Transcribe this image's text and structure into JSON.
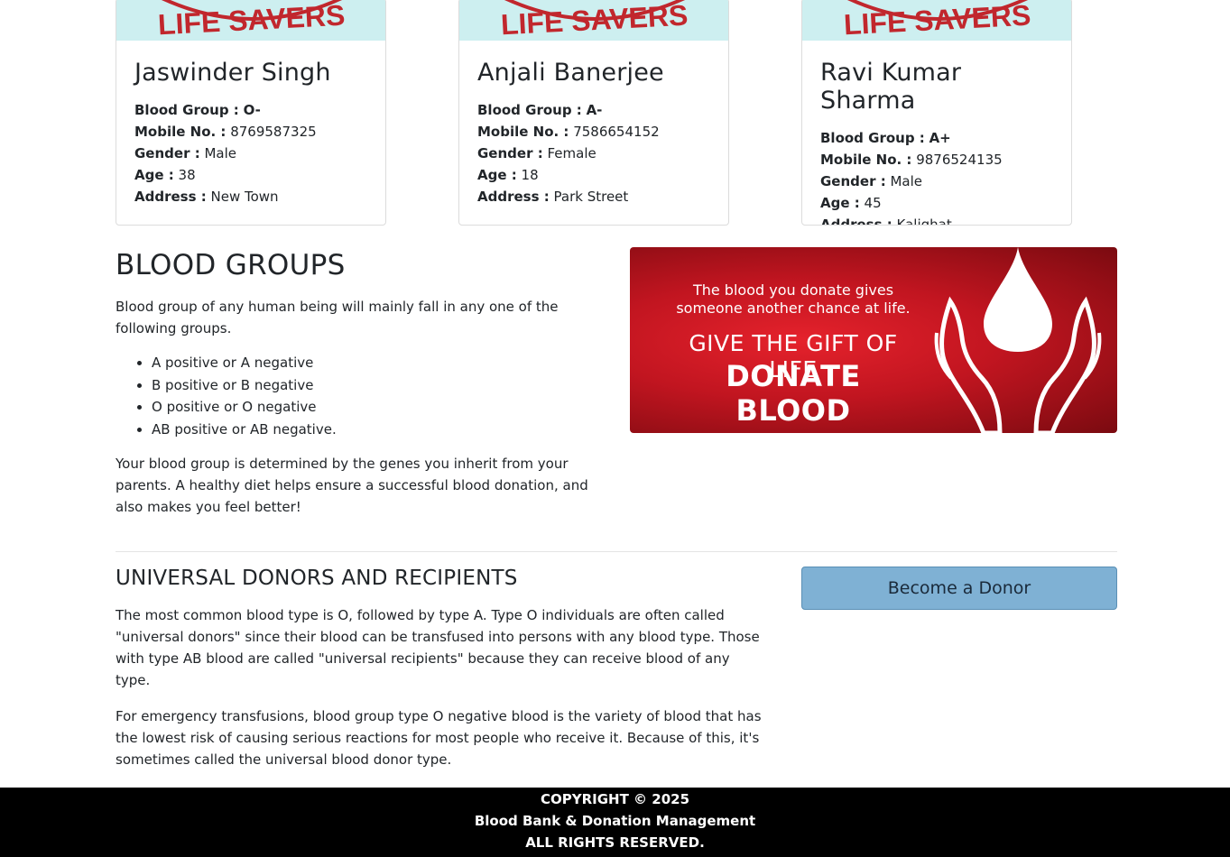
{
  "donors": [
    {
      "image_text": "LIFE SAVERS",
      "name": "Jaswinder Singh",
      "blood_group_label": "Blood Group :",
      "blood_group": "O-",
      "mobile_label": "Mobile No. :",
      "mobile": "8769587325",
      "gender_label": "Gender :",
      "gender": "Male",
      "age_label": "Age :",
      "age": "38",
      "address_label": "Address :",
      "address": "New Town"
    },
    {
      "image_text": "LIFE SAVERS",
      "name": "Anjali Banerjee",
      "blood_group_label": "Blood Group :",
      "blood_group": "A-",
      "mobile_label": "Mobile No. :",
      "mobile": "7586654152",
      "gender_label": "Gender :",
      "gender": "Female",
      "age_label": "Age :",
      "age": "18",
      "address_label": "Address :",
      "address": "Park Street"
    },
    {
      "image_text": "LIFE SAVERS",
      "name": "Ravi Kumar Sharma",
      "blood_group_label": "Blood Group :",
      "blood_group": "A+",
      "mobile_label": "Mobile No. :",
      "mobile": "9876524135",
      "gender_label": "Gender :",
      "gender": "Male",
      "age_label": "Age :",
      "age": "45",
      "address_label": "Address :",
      "address": "Kalighat"
    }
  ],
  "blood_groups": {
    "title": "BLOOD GROUPS",
    "intro": "Blood group of any human being will mainly fall in any one of the following groups.",
    "list": [
      "A positive or A negative",
      "B positive or B negative",
      "O positive or O negative",
      "AB positive or AB negative."
    ],
    "outro": "Your blood group is determined by the genes you inherit from your parents. A healthy diet helps ensure a successful blood donation, and also makes you feel better!"
  },
  "banner": {
    "line1": "The blood you donate gives someone another chance at life.",
    "line2": "GIVE THE GIFT OF LIFE",
    "line3": "DONATE BLOOD",
    "icon": "blood-drop-hands-icon",
    "colors": {
      "red": "#d4161f",
      "dark_red": "#7a0a10"
    }
  },
  "universal": {
    "title": "UNIVERSAL DONORS AND RECIPIENTS",
    "para1": "The most common blood type is O, followed by type A. Type O individuals are often called \"universal donors\" since their blood can be transfused into persons with any blood type. Those with type AB blood are called \"universal recipients\" because they can receive blood of any type.",
    "para2": "For emergency transfusions, blood group type O negative blood is the variety of blood that has the lowest risk of causing serious reactions for most people who receive it. Because of this, it's sometimes called the universal blood donor type."
  },
  "donor_button": {
    "label": "Become a Donor",
    "color": "#7fb1d4"
  },
  "footer": {
    "copyright": "COPYRIGHT © 2025",
    "app_name": "Blood Bank & Donation Management",
    "rights": "ALL RIGHTS RESERVED."
  }
}
